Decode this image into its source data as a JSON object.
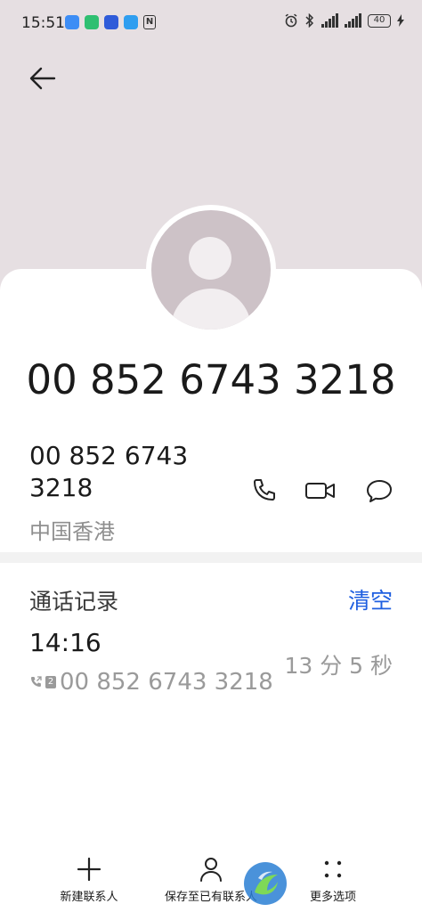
{
  "status_bar": {
    "time": "15:51",
    "battery": "40",
    "app_icons": [
      "chat-app-icon",
      "shield-app-icon",
      "compass-app-icon",
      "browser-app-icon"
    ]
  },
  "contact": {
    "number_title": "00 852 6743 3218",
    "phone_number": "00 852 6743 3218",
    "region": "中国香港"
  },
  "call_log": {
    "title": "通话记录",
    "clear_label": "清空",
    "entries": [
      {
        "time": "14:16",
        "number": "00 852 6743 3218",
        "sim": "2",
        "duration": "13 分 5 秒"
      }
    ]
  },
  "bottom_bar": {
    "new_contact": "新建联系人",
    "save_existing": "保存至已有联系人",
    "more": "更多选项"
  },
  "colors": {
    "hero_bg": "#e6dfe2",
    "accent": "#1f5fe0",
    "avatar_bg": "#cdc2c7"
  }
}
